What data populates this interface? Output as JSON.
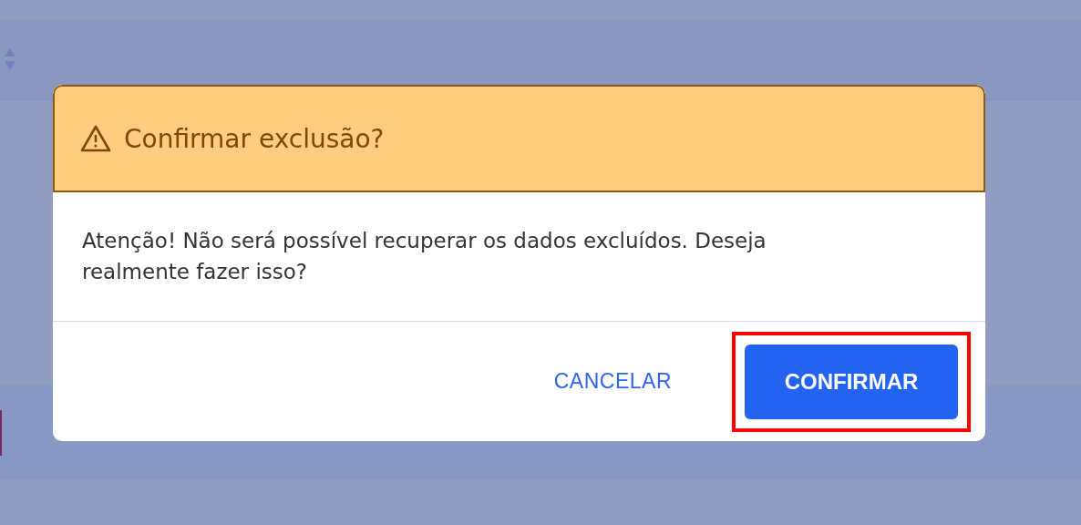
{
  "dialog": {
    "title": "Confirmar exclusão?",
    "message": "Atenção! Não será possível recuperar os dados excluídos. Deseja realmente fazer isso?",
    "buttons": [
      {
        "label": "CANCELAR",
        "kind": "text",
        "highlighted": false
      },
      {
        "label": "CONFIRMAR",
        "kind": "primary",
        "highlighted": true
      }
    ]
  }
}
